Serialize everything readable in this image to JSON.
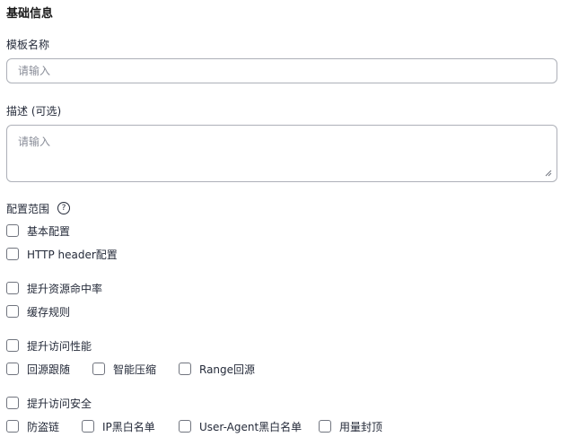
{
  "section_title": "基础信息",
  "template_name": {
    "label": "模板名称",
    "placeholder": "请输入",
    "value": ""
  },
  "description": {
    "label": "描述 (可选)",
    "placeholder": "请输入",
    "value": ""
  },
  "scope": {
    "label": "配置范围",
    "help_icon": "help-circle-icon",
    "help_glyph": "?",
    "options": {
      "basic": {
        "label": "基本配置",
        "checked": false
      },
      "http_header": {
        "label": "HTTP header配置",
        "checked": false
      },
      "hit_rate": {
        "label": "提升资源命中率",
        "checked": false
      },
      "cache_rules": {
        "label": "缓存规则",
        "checked": false
      },
      "performance": {
        "label": "提升访问性能",
        "checked": false
      },
      "origin_follow": {
        "label": "回源跟随",
        "checked": false
      },
      "smart_compress": {
        "label": "智能压缩",
        "checked": false
      },
      "range_origin": {
        "label": "Range回源",
        "checked": false
      },
      "security": {
        "label": "提升访问安全",
        "checked": false
      },
      "hotlink": {
        "label": "防盗链",
        "checked": false
      },
      "ip_list": {
        "label": "IP黑白名单",
        "checked": false
      },
      "ua_list": {
        "label": "User-Agent黑白名单",
        "checked": false
      },
      "usage_cap": {
        "label": "用量封顶",
        "checked": false
      }
    }
  },
  "colors": {
    "border": "#adb0b8",
    "text": "#252b3a",
    "placeholder": "#8a8e99",
    "checkbox_border": "#71757f"
  }
}
